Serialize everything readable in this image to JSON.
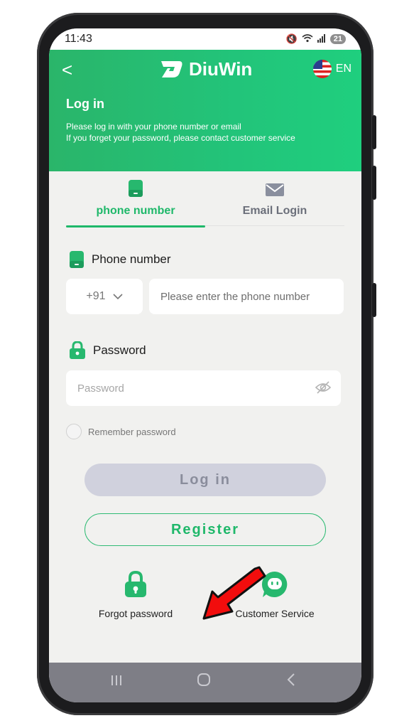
{
  "status": {
    "time": "11:43",
    "battery": "21"
  },
  "header": {
    "back": "<",
    "brand": "DiuWin",
    "lang": "EN",
    "title": "Log in",
    "subtitle_1": "Please log in with your phone number or email",
    "subtitle_2": "If you forget your password, please contact customer service",
    "bg_color": "#22c47a"
  },
  "tabs": [
    {
      "label": "phone number",
      "active": true,
      "icon": "phone-icon"
    },
    {
      "label": "Email Login",
      "active": false,
      "icon": "mail-icon"
    }
  ],
  "phone_section": {
    "label": "Phone number",
    "country_code": "+91",
    "placeholder": "Please enter the phone number"
  },
  "password_section": {
    "label": "Password",
    "placeholder": "Password"
  },
  "remember": "Remember password",
  "buttons": {
    "login": "Log in",
    "register": "Register"
  },
  "bottom": {
    "forgot": "Forgot password",
    "service": "Customer Service"
  },
  "accent_color": "#1fb86a"
}
